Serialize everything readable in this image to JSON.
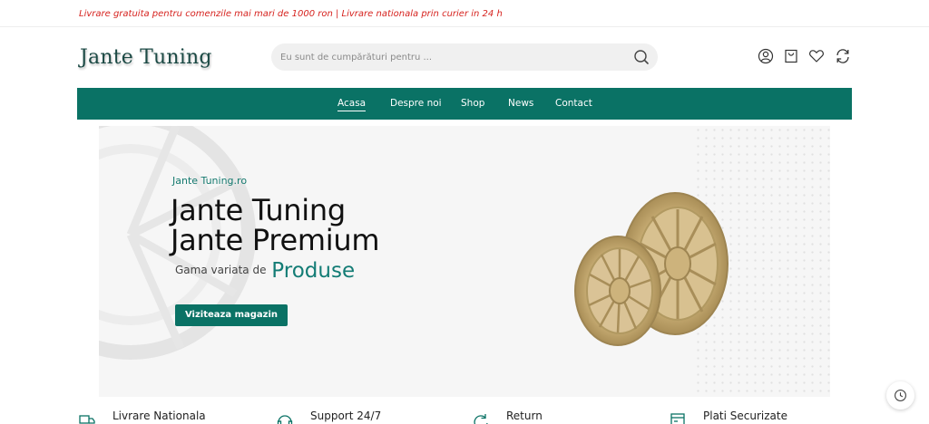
{
  "topbar": {
    "promo": "Livrare gratuita pentru comenzile mai mari de 1000 ron | Livrare nationala prin curier in 24 h"
  },
  "header": {
    "logo": "Jante Tuning",
    "search": {
      "placeholder": "Eu sunt de cumpărături pentru ...",
      "value": ""
    },
    "icons": [
      "user-icon",
      "bag-icon",
      "heart-icon",
      "compare-icon"
    ]
  },
  "nav": {
    "items": [
      "Acasa",
      "Despre noi",
      "Shop",
      "News",
      "Contact"
    ],
    "active": "Acasa"
  },
  "hero": {
    "kicker": "Jante Tuning.ro",
    "title_line1": "Jante Tuning",
    "title_line2": "Jante Premium",
    "subtitle": "Gama variata de",
    "subtitle_highlight": "Produse",
    "cta": "Viziteaza magazin"
  },
  "features": [
    {
      "label": "Livrare Nationala",
      "icon": "truck-icon"
    },
    {
      "label": "Support 24/7",
      "icon": "headset-icon"
    },
    {
      "label": "Return",
      "icon": "return-icon"
    },
    {
      "label": "Plati Securizate",
      "icon": "payment-icon"
    }
  ],
  "colors": {
    "accent": "#0a7265",
    "promo": "#d6231f",
    "highlight": "#137c75",
    "wheel": "#c8b07a"
  },
  "floating": {
    "icon": "history-icon"
  }
}
